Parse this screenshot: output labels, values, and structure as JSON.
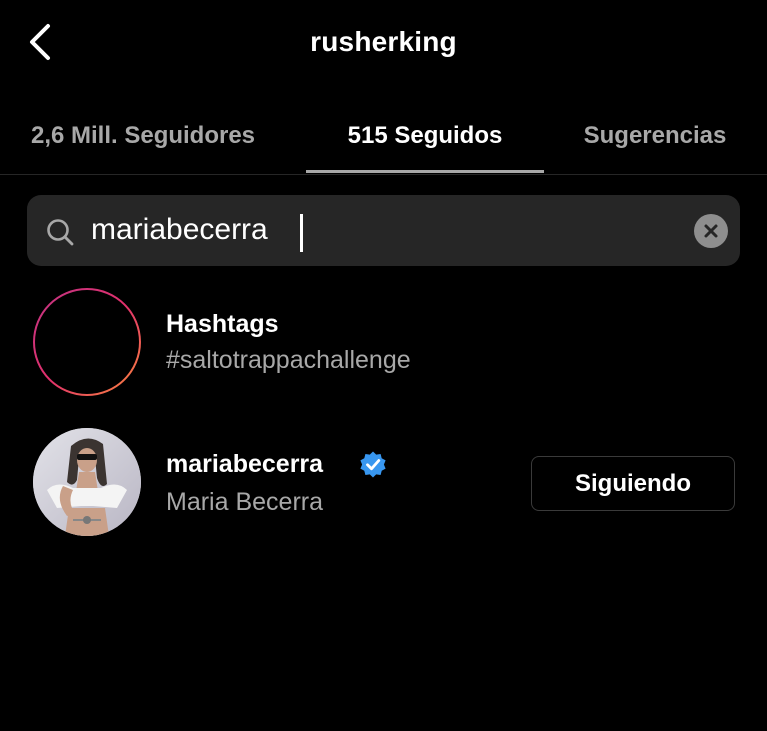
{
  "header": {
    "title": "rusherking"
  },
  "tabs": [
    {
      "label": "2,6 Mill. Seguidores",
      "active": false
    },
    {
      "label": "515 Seguidos",
      "active": true
    },
    {
      "label": "Sugerencias",
      "active": false
    }
  ],
  "search": {
    "value": "mariabecerra"
  },
  "results": [
    {
      "type": "hashtag",
      "title": "Hashtags",
      "subtitle": "#saltotrappachallenge"
    },
    {
      "type": "user",
      "title": "mariabecerra",
      "subtitle": "Maria Becerra",
      "verified": true,
      "button_label": "Siguiendo"
    }
  ],
  "colors": {
    "background": "#000000",
    "search_bg": "#262626",
    "secondary_text": "#a8a8a8",
    "verified_blue": "#3897f0"
  }
}
